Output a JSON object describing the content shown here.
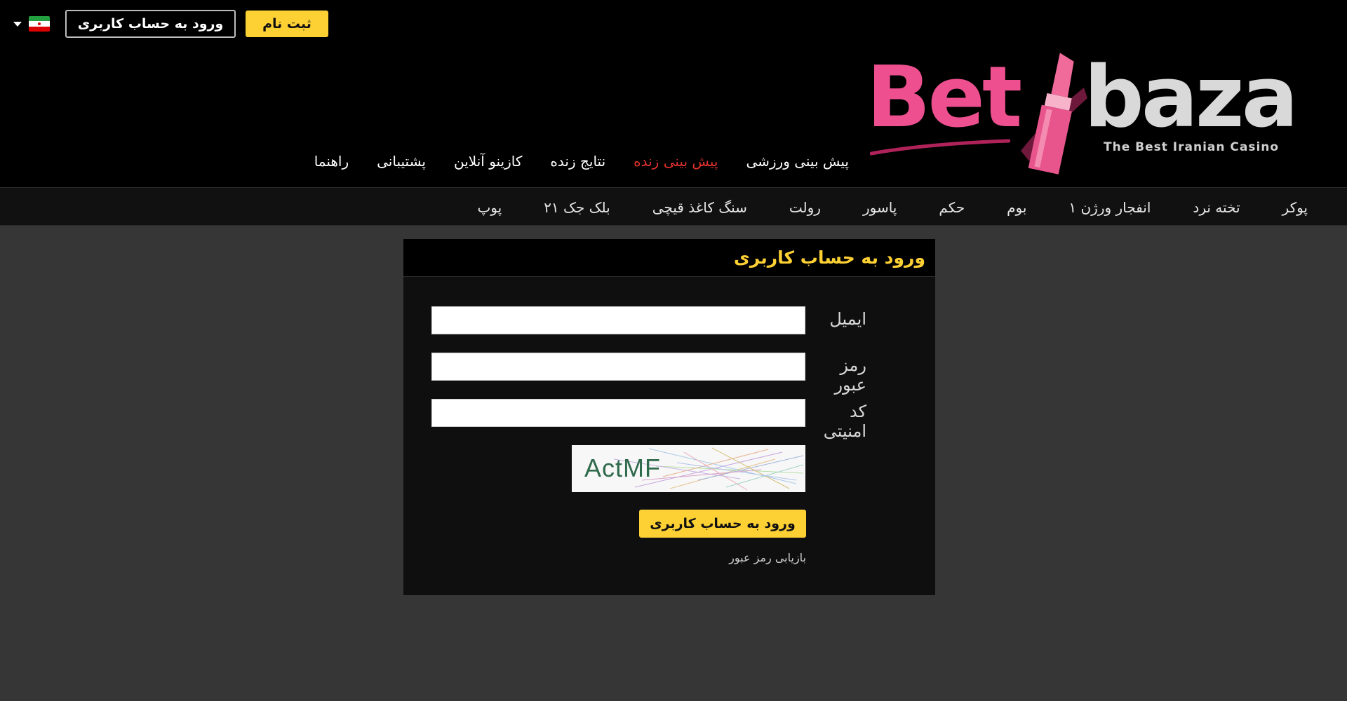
{
  "topbar": {
    "login_label": "ورود به حساب کاربری",
    "register_label": "ثبت نام",
    "language_flag": "iran-flag-icon"
  },
  "logo": {
    "bet": "Bet",
    "baza": "baza",
    "tagline": "The Best Iranian Casino"
  },
  "main_nav": {
    "items": [
      {
        "label": "پیش بینی ورزشی"
      },
      {
        "label": "پیش بینی زنده",
        "active": true
      },
      {
        "label": "نتایج زنده"
      },
      {
        "label": "کازینو آنلاین"
      },
      {
        "label": "پشتیبانی"
      },
      {
        "label": "راهنما"
      }
    ]
  },
  "sub_nav": {
    "items": [
      {
        "label": "پوکر"
      },
      {
        "label": "تخته نرد"
      },
      {
        "label": "انفجار ورژن ۱"
      },
      {
        "label": "بوم"
      },
      {
        "label": "حکم"
      },
      {
        "label": "پاسور"
      },
      {
        "label": "رولت"
      },
      {
        "label": "سنگ کاغذ قیچی"
      },
      {
        "label": "بلک جک ۲۱"
      },
      {
        "label": "پوپ"
      }
    ]
  },
  "login_form": {
    "title": "ورود به حساب کاربری",
    "email_label": "ایمیل",
    "email_value": "",
    "password_label": "رمز عبور",
    "password_value": "",
    "security_code_label": "کد امنیتی",
    "security_code_value": "",
    "captcha_text": "ActMF",
    "submit_label": "ورود به حساب کاربری",
    "forgot_label": "بازیابی رمز عبور"
  },
  "colors": {
    "accent_yellow": "#fdd034",
    "active_red": "#e4322f",
    "page_bg": "#363636",
    "header_bg": "#000000"
  }
}
